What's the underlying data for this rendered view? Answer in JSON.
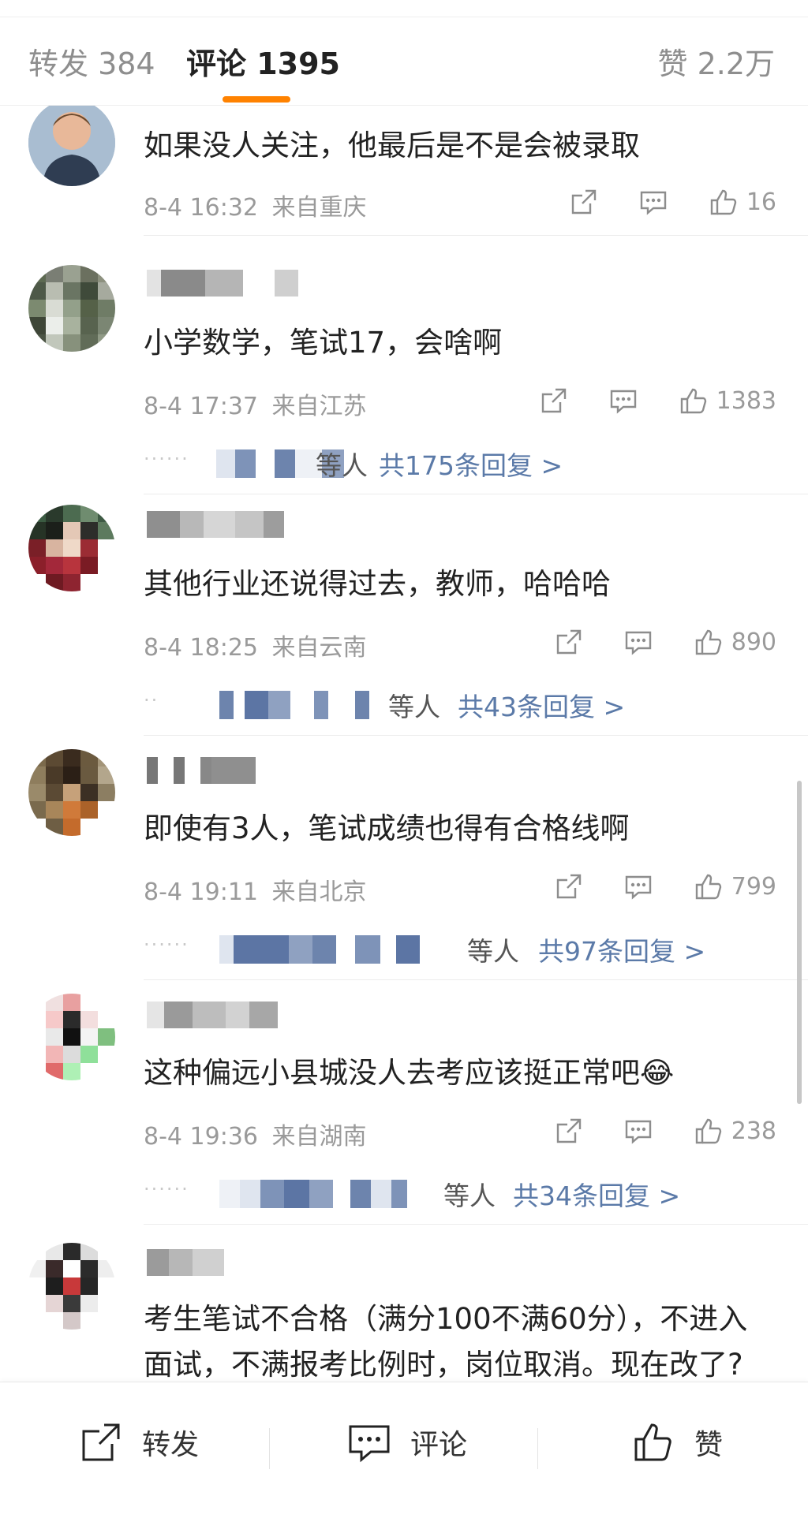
{
  "tabs": {
    "forward_label": "转发 384",
    "comment_label": "评论 1395",
    "like_label": "赞 2.2万"
  },
  "comments": [
    {
      "content": "如果没人关注，他最后是不是会被录取",
      "time": "8-4 16:32",
      "location": "来自重庆",
      "likes": "16"
    },
    {
      "content": "小学数学，笔试17，会啥啊",
      "time": "8-4 17:37",
      "location": "来自江苏",
      "likes": "1383",
      "reply_people": "等人",
      "reply_link": "共175条回复 >"
    },
    {
      "content": "其他行业还说得过去，教师，哈哈哈",
      "time": "8-4 18:25",
      "location": "来自云南",
      "likes": "890",
      "reply_people": "等人",
      "reply_link": "共43条回复 >"
    },
    {
      "content": "即使有3人，笔试成绩也得有合格线啊",
      "time": "8-4 19:11",
      "location": "来自北京",
      "likes": "799",
      "reply_people": "等人",
      "reply_link": "共97条回复 >"
    },
    {
      "content": "这种偏远小县城没人去考应该挺正常吧😂",
      "time": "8-4 19:36",
      "location": "来自湖南",
      "likes": "238",
      "reply_people": "等人",
      "reply_link": "共34条回复 >"
    },
    {
      "content": "考生笔试不合格（满分100不满60分），不进入面试，不满报考比例时，岗位取消。现在改了?"
    }
  ],
  "bottom_bar": {
    "forward_label": "转发",
    "comment_label": "评论",
    "like_label": "赞"
  },
  "icons": [
    "share-icon",
    "comment-icon",
    "thumbs-up-icon"
  ],
  "colors": {
    "accent": "#ff8200",
    "link": "#5b7aa8",
    "meta": "#9a9a9a"
  }
}
